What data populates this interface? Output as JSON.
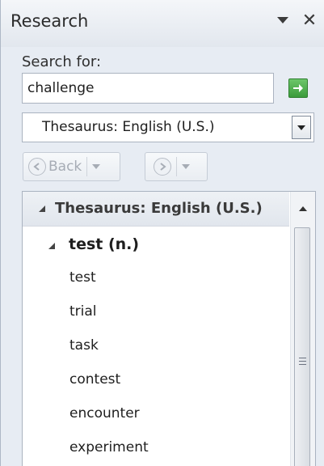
{
  "pane": {
    "title": "Research",
    "dropdown_icon": "triangle-down-icon",
    "close_symbol": "✕"
  },
  "search": {
    "label": "Search for:",
    "value": "challenge",
    "go_icon": "green-arrow-right-icon"
  },
  "source_select": {
    "selected": "Thesaurus: English (U.S.)"
  },
  "navigation": {
    "back_label": "Back",
    "back_enabled": false,
    "forward_enabled": false
  },
  "results": {
    "header": "Thesaurus: English (U.S.)",
    "entry": "test (n.)",
    "words": [
      "test",
      "trial",
      "task",
      "contest",
      "encounter",
      "experiment"
    ]
  },
  "colors": {
    "pane_bg": "#e7ecf3",
    "go_green": "#3b9b3b"
  }
}
